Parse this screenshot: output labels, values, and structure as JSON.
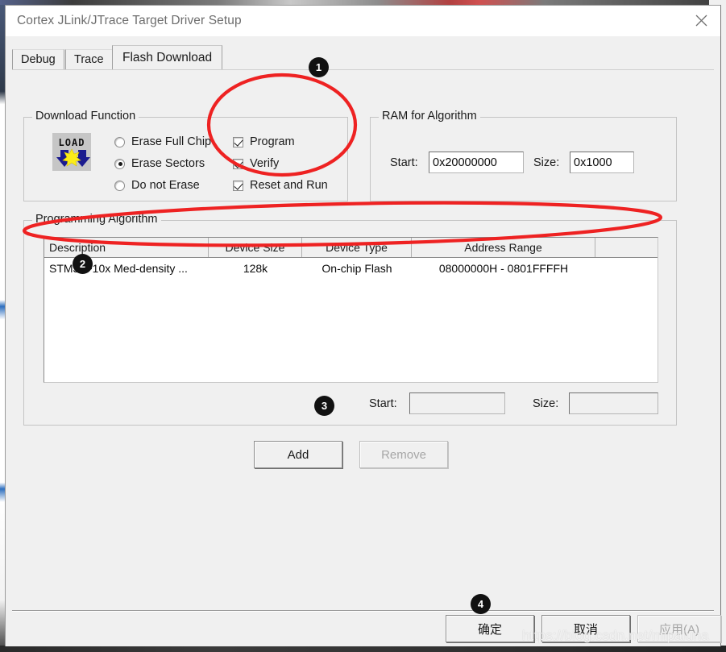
{
  "window": {
    "title": "Cortex JLink/JTrace Target Driver Setup",
    "close_icon": "close-icon"
  },
  "tabs": [
    {
      "label": "Debug",
      "active": false
    },
    {
      "label": "Trace",
      "active": false
    },
    {
      "label": "Flash Download",
      "active": true
    }
  ],
  "download_function": {
    "title": "Download Function",
    "icon": "load-icon",
    "icon_text": "LOAD",
    "radios": [
      {
        "label": "Erase Full Chip",
        "selected": false
      },
      {
        "label": "Erase Sectors",
        "selected": true
      },
      {
        "label": "Do not Erase",
        "selected": false
      }
    ],
    "checkboxes": [
      {
        "label": "Program",
        "checked": true
      },
      {
        "label": "Verify",
        "checked": true
      },
      {
        "label": "Reset and Run",
        "checked": true
      }
    ]
  },
  "ram_for_algorithm": {
    "title": "RAM for Algorithm",
    "start_label": "Start:",
    "start_value": "0x20000000",
    "size_label": "Size:",
    "size_value": "0x1000"
  },
  "programming_algorithm": {
    "title": "Programming Algorithm",
    "columns": [
      "Description",
      "Device Size",
      "Device Type",
      "Address Range",
      ""
    ],
    "rows": [
      {
        "description": "STM32F10x Med-density ...",
        "device_size": "128k",
        "device_type": "On-chip Flash",
        "address_range": "08000000H - 0801FFFFH",
        "extra": ""
      }
    ],
    "start_label": "Start:",
    "start_value": "",
    "size_label": "Size:",
    "size_value": ""
  },
  "actions": {
    "add_label": "Add",
    "add_enabled": true,
    "remove_label": "Remove",
    "remove_enabled": false
  },
  "footer": {
    "ok_label": "确定",
    "cancel_label": "取消",
    "apply_label": "应用(A)",
    "apply_enabled": false
  },
  "annotations": {
    "badges": [
      "1",
      "2",
      "3",
      "4"
    ],
    "highlight_color": "#ee2222",
    "badge_color": "#111111",
    "watermark": "https://blog.csdn.net/mipaluna"
  }
}
